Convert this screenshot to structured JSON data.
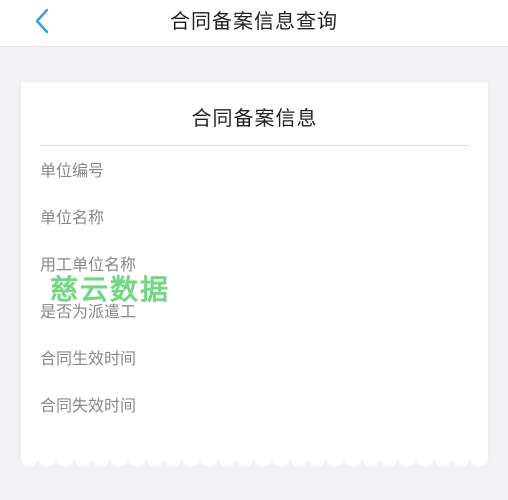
{
  "nav": {
    "back_icon": "chevron-left-icon",
    "title": "合同备案信息查询"
  },
  "card": {
    "title": "合同备案信息",
    "fields": [
      "单位编号",
      "单位名称",
      "用工单位名称",
      "是否为派遣工",
      "合同生效时间",
      "合同失效时间"
    ]
  },
  "watermark": {
    "text": "慈云数据",
    "color": "#46c85a"
  },
  "colors": {
    "accent": "#3aa0d8",
    "background": "#f2f2f5"
  }
}
